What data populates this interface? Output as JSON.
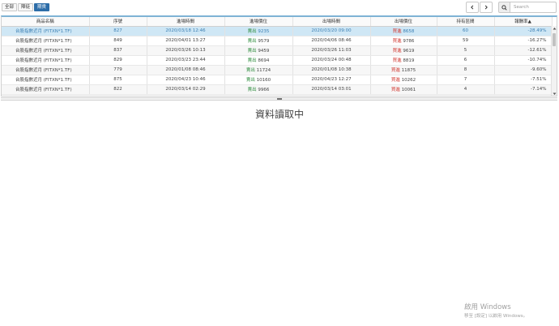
{
  "toolbar": {
    "filters": [
      {
        "label": "全部",
        "active": false
      },
      {
        "label": "陣徒",
        "active": false
      },
      {
        "label": "期貨",
        "active": true
      }
    ],
    "search_placeholder": "Search"
  },
  "columns": [
    {
      "label": "商品名稱",
      "sort": ""
    },
    {
      "label": "序號",
      "sort": ""
    },
    {
      "label": "進場時間",
      "sort": ""
    },
    {
      "label": "進場價位",
      "sort": ""
    },
    {
      "label": "出場時間",
      "sort": ""
    },
    {
      "label": "出場價位",
      "sort": ""
    },
    {
      "label": "持有區間",
      "sort": ""
    },
    {
      "label": "報酬率",
      "sort": "▲"
    }
  ],
  "rows": [
    {
      "name": "台股指數近月 (FITXN*1.TF)",
      "seq": "827",
      "entry_time": "2020/03/18 12:46",
      "entry_side": "賣出",
      "entry_price": "9235",
      "exit_time": "2020/03/20 09:00",
      "exit_side": "買進",
      "exit_price": "8658",
      "hold": "60",
      "ret": "-28.49%"
    },
    {
      "name": "台股指數近月 (FITXN*1.TF)",
      "seq": "849",
      "entry_time": "2020/04/01 13:27",
      "entry_side": "賣出",
      "entry_price": "9579",
      "exit_time": "2020/04/06 08:46",
      "exit_side": "買進",
      "exit_price": "9786",
      "hold": "59",
      "ret": "-16.27%"
    },
    {
      "name": "台股指數近月 (FITXN*1.TF)",
      "seq": "837",
      "entry_time": "2020/03/26 10:13",
      "entry_side": "賣出",
      "entry_price": "9459",
      "exit_time": "2020/03/26 11:03",
      "exit_side": "買進",
      "exit_price": "9619",
      "hold": "5",
      "ret": "-12.61%"
    },
    {
      "name": "台股指數近月 (FITXN*1.TF)",
      "seq": "829",
      "entry_time": "2020/03/23 23:44",
      "entry_side": "賣出",
      "entry_price": "8694",
      "exit_time": "2020/03/24 00:48",
      "exit_side": "買進",
      "exit_price": "8819",
      "hold": "6",
      "ret": "-10.74%"
    },
    {
      "name": "台股指數近月 (FITXN*1.TF)",
      "seq": "779",
      "entry_time": "2020/01/08 08:46",
      "entry_side": "賣出",
      "entry_price": "11724",
      "exit_time": "2020/01/08 10:38",
      "exit_side": "買進",
      "exit_price": "11875",
      "hold": "8",
      "ret": "-9.60%"
    },
    {
      "name": "台股指數近月 (FITXN*1.TF)",
      "seq": "875",
      "entry_time": "2020/04/23 10:46",
      "entry_side": "賣出",
      "entry_price": "10160",
      "exit_time": "2020/04/23 12:27",
      "exit_side": "買進",
      "exit_price": "10262",
      "hold": "7",
      "ret": "-7.51%"
    },
    {
      "name": "台股指數近月 (FITXN*1.TF)",
      "seq": "822",
      "entry_time": "2020/03/14 02:29",
      "entry_side": "賣出",
      "entry_price": "9966",
      "exit_time": "2020/03/14 03:01",
      "exit_side": "買進",
      "exit_price": "10061",
      "hold": "4",
      "ret": "-7.14%"
    }
  ],
  "loading_text": "資料讀取中",
  "watermark": {
    "title": "啟用 Windows",
    "subtitle": "移至 [設定] 以啟用 Windows。"
  },
  "icons": {
    "prev": "chevron-left-icon",
    "next": "chevron-right-icon",
    "search": "search-icon"
  },
  "colors": {
    "selected_row": "#cfe7f5",
    "accent": "#2d6da8",
    "sell": "#2a8a3a",
    "buy": "#d0342c"
  }
}
